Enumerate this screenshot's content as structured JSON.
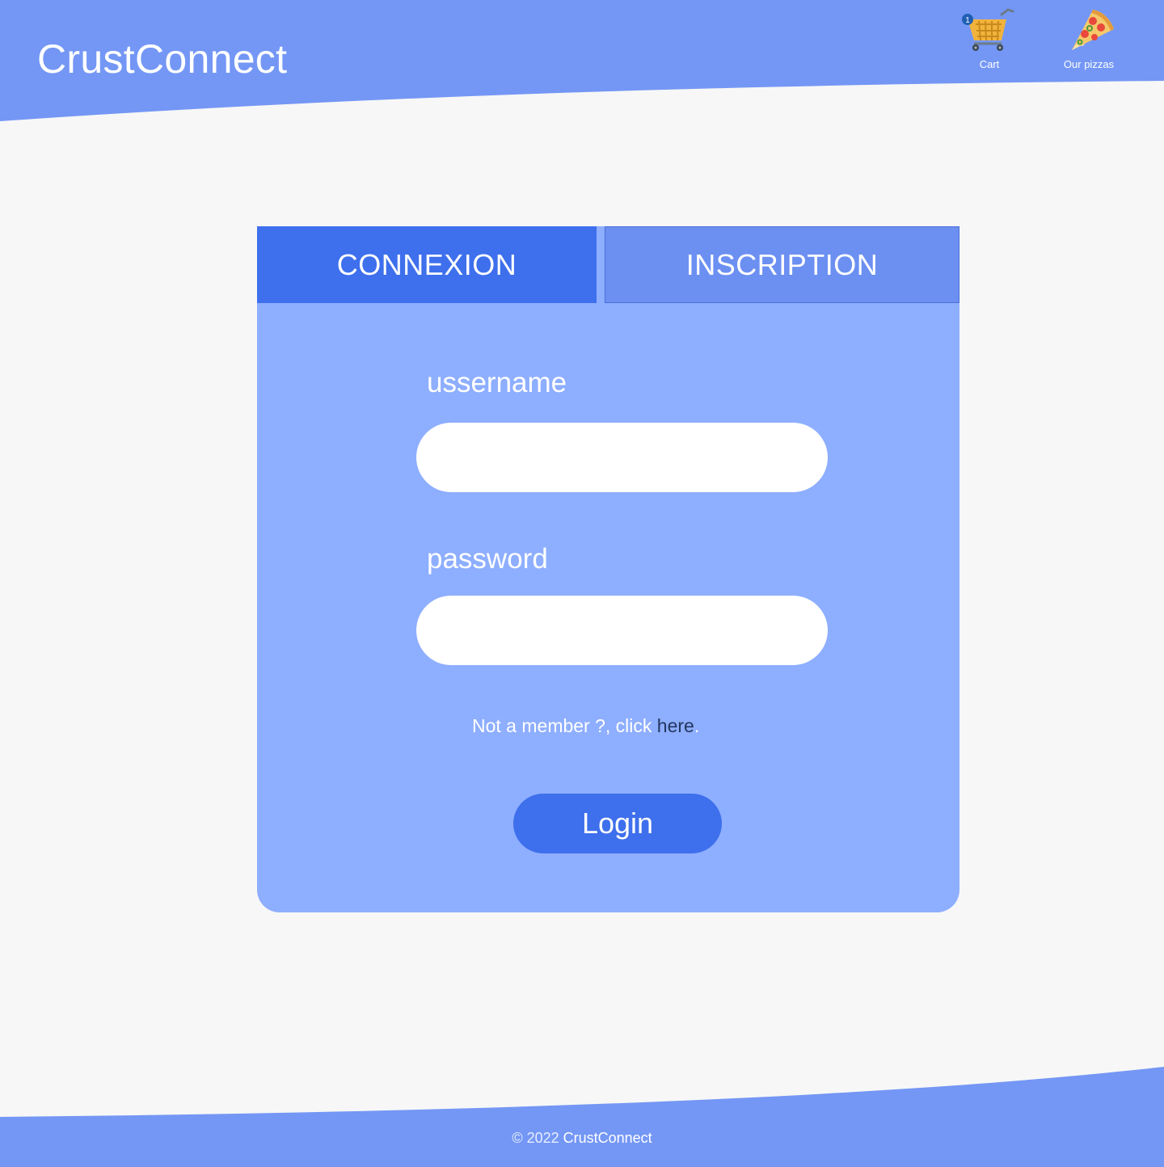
{
  "header": {
    "brand": "CrustConnect",
    "nav": {
      "cart_label": "Cart",
      "cart_badge": "1",
      "pizzas_label": "Our pizzas"
    },
    "color": "#7497f5"
  },
  "auth_card": {
    "tabs": [
      {
        "label": "CONNEXION",
        "active": true
      },
      {
        "label": "INSCRIPTION",
        "active": false
      }
    ],
    "username_label": "ussername",
    "username_value": "",
    "password_label": "password",
    "password_value": "",
    "member_prefix": "Not a member ?, click ",
    "member_link": "here",
    "member_suffix": ".",
    "login_label": "Login",
    "colors": {
      "card": "#8eaeff",
      "active_tab": "#3e6fec",
      "inactive_tab": "#6c90f1"
    }
  },
  "footer": {
    "copyright": "© 2022 ",
    "brand": "CrustConnect"
  }
}
